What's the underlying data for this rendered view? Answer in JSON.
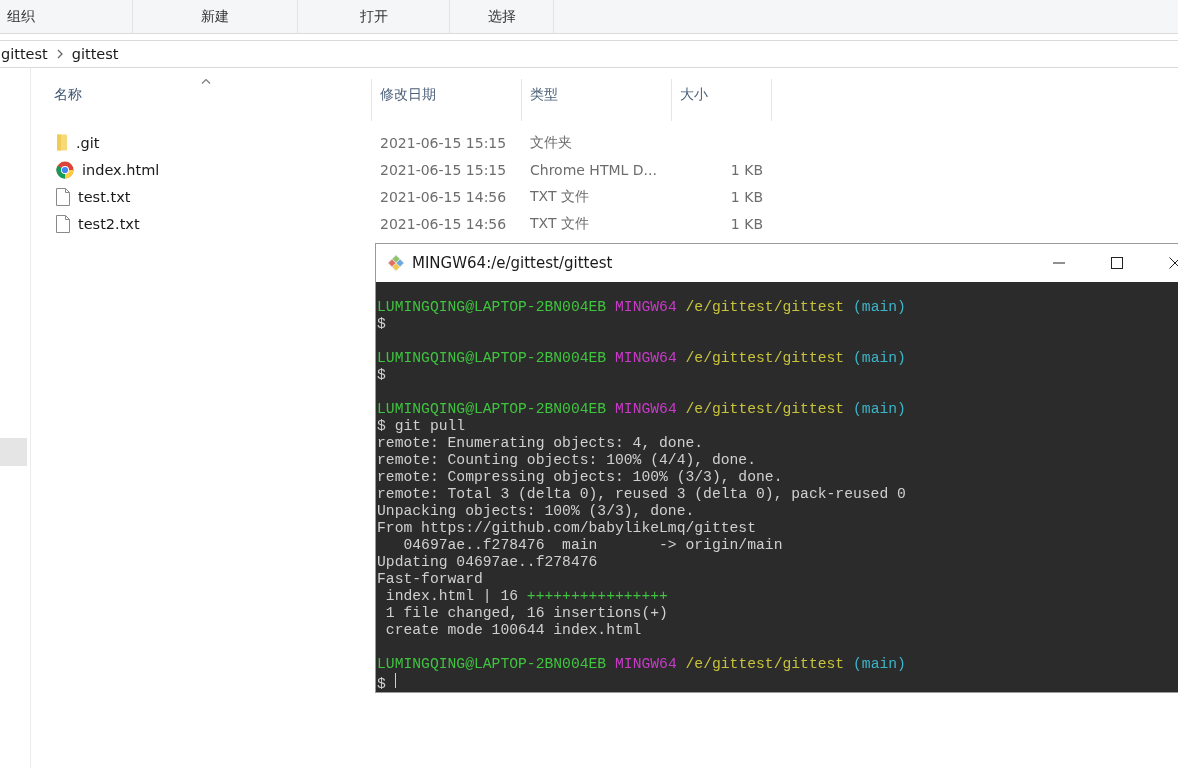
{
  "toolbar": {
    "groups": [
      "组织",
      "新建",
      "打开",
      "选择"
    ]
  },
  "breadcrumb": [
    "gittest",
    "gittest"
  ],
  "columns": [
    {
      "label": "名称",
      "sorted": true
    },
    {
      "label": "修改日期",
      "sorted": false
    },
    {
      "label": "类型",
      "sorted": false
    },
    {
      "label": "大小",
      "sorted": false
    }
  ],
  "files": [
    {
      "name": ".git",
      "kind": "folder",
      "modified": "2021-06-15 15:15",
      "type": "文件夹"
    },
    {
      "name": "index.html",
      "kind": "chrome",
      "modified": "2021-06-15 15:15",
      "type": "Chrome HTML D...",
      "size": "1 KB"
    },
    {
      "name": "test.txt",
      "kind": "text",
      "modified": "2021-06-15 14:56",
      "type": "TXT 文件",
      "size": "1 KB"
    },
    {
      "name": "test2.txt",
      "kind": "text",
      "modified": "2021-06-15 14:56",
      "type": "TXT 文件",
      "size": "1 KB"
    }
  ],
  "terminal": {
    "title": "MINGW64:/e/gittest/gittest",
    "blocks": [
      [
        {
          "kind": "prompt",
          "user": "LUMINGQING@LAPTOP-2BN004EB",
          "shell": "MINGW64",
          "path": "/e/gittest/gittest",
          "branch": "(main)"
        },
        {
          "kind": "output",
          "text": "$"
        }
      ],
      [
        {
          "kind": "prompt",
          "user": "LUMINGQING@LAPTOP-2BN004EB",
          "shell": "MINGW64",
          "path": "/e/gittest/gittest",
          "branch": "(main)"
        },
        {
          "kind": "output",
          "text": "$"
        }
      ],
      [
        {
          "kind": "prompt",
          "user": "LUMINGQING@LAPTOP-2BN004EB",
          "shell": "MINGW64",
          "path": "/e/gittest/gittest",
          "branch": "(main)"
        },
        {
          "kind": "output",
          "text": "$ git pull"
        },
        {
          "kind": "output",
          "text": "remote: Enumerating objects: 4, done."
        },
        {
          "kind": "output",
          "text": "remote: Counting objects: 100% (4/4), done."
        },
        {
          "kind": "output",
          "text": "remote: Compressing objects: 100% (3/3), done."
        },
        {
          "kind": "output",
          "text": "remote: Total 3 (delta 0), reused 3 (delta 0), pack-reused 0"
        },
        {
          "kind": "output",
          "text": "Unpacking objects: 100% (3/3), done."
        },
        {
          "kind": "output",
          "text": "From https://github.com/babylikeLmq/gittest"
        },
        {
          "kind": "output",
          "text": "   04697ae..f278476  main       -> origin/main"
        },
        {
          "kind": "output",
          "text": "Updating 04697ae..f278476"
        },
        {
          "kind": "output",
          "text": "Fast-forward"
        },
        {
          "kind": "diffstat",
          "text": " index.html | 16 ",
          "plus": "++++++++++++++++"
        },
        {
          "kind": "output",
          "text": " 1 file changed, 16 insertions(+)"
        },
        {
          "kind": "output",
          "text": " create mode 100644 index.html"
        }
      ],
      [
        {
          "kind": "prompt",
          "user": "LUMINGQING@LAPTOP-2BN004EB",
          "shell": "MINGW64",
          "path": "/e/gittest/gittest",
          "branch": "(main)"
        },
        {
          "kind": "input",
          "text": "$",
          "cursor": true
        }
      ]
    ]
  }
}
